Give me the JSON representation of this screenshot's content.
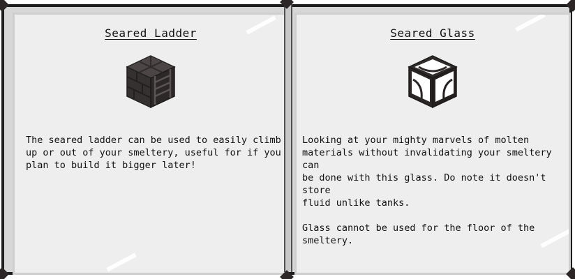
{
  "book": {
    "left_page": {
      "title": "Seared Ladder",
      "icon": "seared-ladder-block-icon",
      "text": "The seared ladder can be used to easily climb\nup or out of your smeltery, useful for if you\nplan to build it bigger later!"
    },
    "right_page": {
      "title": "Seared Glass",
      "icon": "seared-glass-block-icon",
      "text": "Looking at your mighty marvels of molten\nmaterials without invalidating your smeltery can\nbe done with this glass. Do note it doesn't store\nfluid unlike tanks.\n\nGlass cannot be used for the floor of the\nsmeltery."
    }
  },
  "colors": {
    "page": "#eeeeee",
    "frame": "#1d1d1d",
    "seared": "#3a3636",
    "text": "#111111"
  }
}
